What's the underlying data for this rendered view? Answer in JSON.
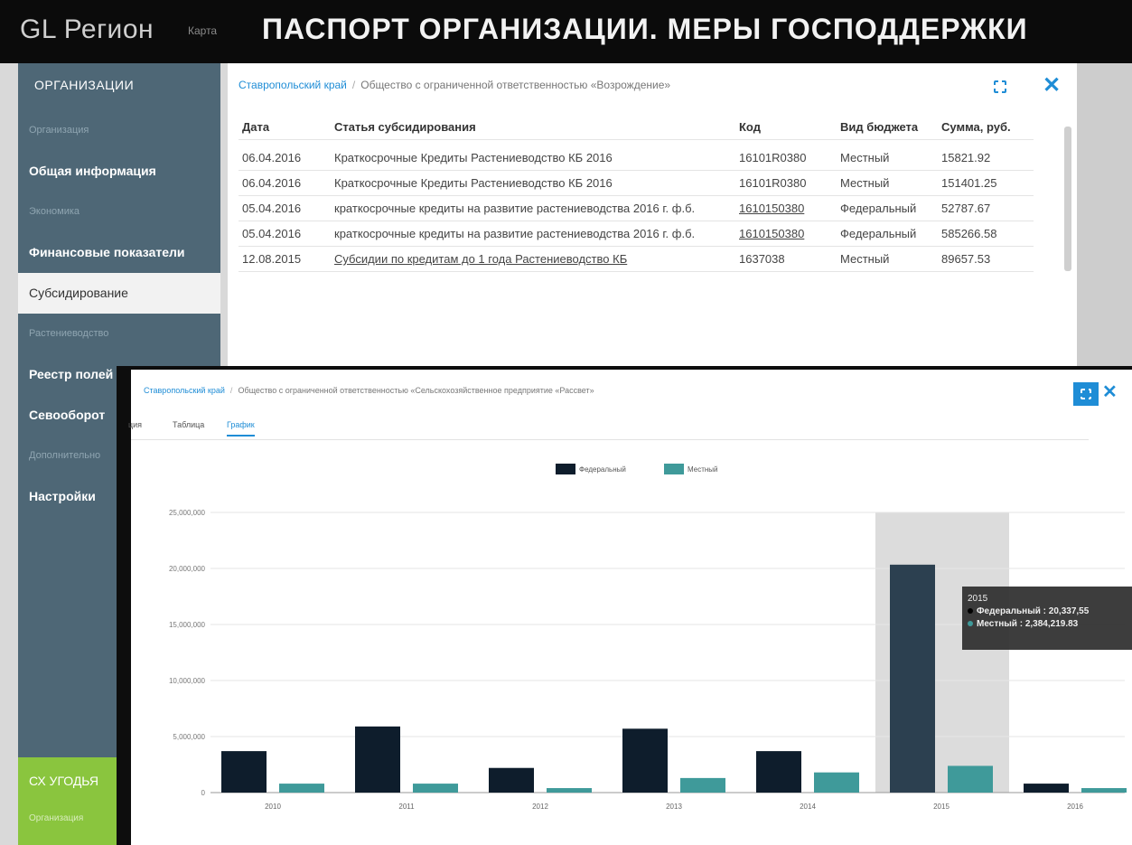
{
  "app": {
    "brand": "GL Регион",
    "map_link": "Карта",
    "title": "ПАСПОРТ ОРГАНИЗАЦИИ. МЕРЫ ГОСПОДДЕРЖКИ"
  },
  "sidebar": {
    "header": "ОРГАНИЗАЦИИ",
    "items": [
      {
        "label": "Организация"
      },
      {
        "label": "Общая информация"
      },
      {
        "label": "Экономика"
      },
      {
        "label": "Финансовые показатели"
      },
      {
        "label": "Субсидирование"
      },
      {
        "label": "Растениеводство"
      },
      {
        "label": "Реестр полей"
      },
      {
        "label": "Севооборот"
      },
      {
        "label": "Дополнительно"
      },
      {
        "label": "Настройки"
      }
    ],
    "green_title": "СХ УГОДЬЯ",
    "green_sub": "Организация"
  },
  "table_panel": {
    "crumb_region": "Ставропольский край",
    "crumb_sep": "/",
    "crumb_org": "Общество с ограниченной ответственностью «Возрождение»",
    "columns": [
      "Дата",
      "Статья субсидирования",
      "Код",
      "Вид бюджета",
      "Сумма, руб."
    ],
    "rows": [
      {
        "date": "06.04.2016",
        "article": "Краткосрочные Кредиты Растениеводство КБ 2016",
        "code": "16101R0380",
        "budget": "Местный",
        "sum": "15821.92"
      },
      {
        "date": "06.04.2016",
        "article": "Краткосрочные Кредиты Растениеводство КБ 2016",
        "code": "16101R0380",
        "budget": "Местный",
        "sum": "151401.25"
      },
      {
        "date": "05.04.2016",
        "article": "краткосрочные кредиты на развитие растениеводства 2016 г. ф.б.",
        "code": "1610150380",
        "budget": "Федеральный",
        "sum": "52787.67"
      },
      {
        "date": "05.04.2016",
        "article": "краткосрочные кредиты на развитие растениеводства 2016 г. ф.б.",
        "code": "1610150380",
        "budget": "Федеральный",
        "sum": "585266.58"
      },
      {
        "date": "12.08.2015",
        "article": "Субсидии по кредитам до 1 года Растениеводство КБ",
        "code": "1637038",
        "budget": "Местный",
        "sum": "89657.53"
      }
    ]
  },
  "chart_panel": {
    "crumb_region": "Ставропольский край",
    "crumb_sep": "/",
    "crumb_org": "Общество с ограниченной ответственностью «Сельскохозяйственное предприятие «Рассвет»",
    "tabs": [
      "Таблица",
      "График"
    ],
    "tab_partial": "ция",
    "tooltip": {
      "year": "2015",
      "line1": "Федеральный : 20,337,55",
      "line2": "Местный : 2,384,219.83"
    }
  },
  "colors": {
    "federal": "#0e1d2c",
    "local": "#3f9a9a",
    "link": "#1f8dd6",
    "sidebar": "#4e6776"
  },
  "chart_data": {
    "type": "bar",
    "categories": [
      "2010",
      "2011",
      "2012",
      "2013",
      "2014",
      "2015",
      "2016"
    ],
    "series": [
      {
        "name": "Федеральный",
        "values": [
          3700000,
          5900000,
          2200000,
          5700000,
          3700000,
          20337550,
          800000
        ]
      },
      {
        "name": "Местный",
        "values": [
          800000,
          800000,
          400000,
          1300000,
          1800000,
          2384219.83,
          400000
        ]
      }
    ],
    "yticks": [
      "25,000,000",
      "20,000,000",
      "15,000,000",
      "10,000,000",
      "5,000,000",
      "0"
    ],
    "ylim": [
      0,
      25000000
    ],
    "legend": "top-center",
    "highlight": "2015"
  }
}
